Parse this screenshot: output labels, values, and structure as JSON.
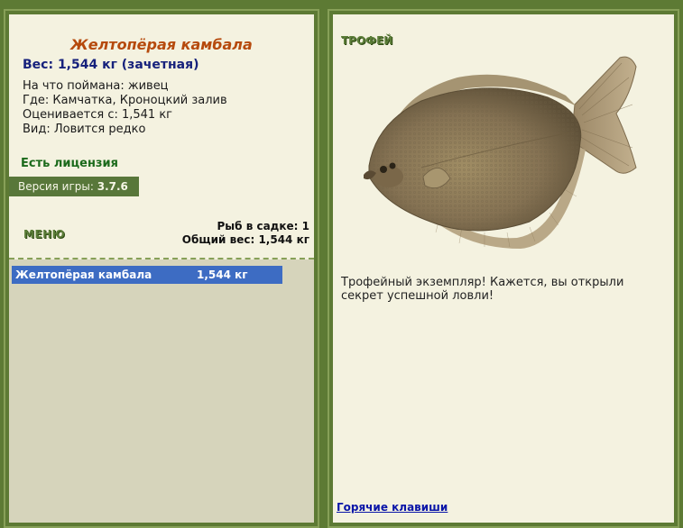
{
  "fish": {
    "name": "Желтопёрая камбала",
    "weight": "Вес: 1,544 кг (зачетная)",
    "bait": "На что поймана: живец",
    "location": "Где: Камчатка, Кроноцкий залив",
    "min_weight": "Оценивается с: 1,541 кг",
    "rarity": "Вид: Ловится редко"
  },
  "license": "Есть лицензия",
  "version": {
    "label": "Версия игры: ",
    "value": "3.7.6"
  },
  "menu_label": "МЕНЮ",
  "cage": {
    "count_label": "Рыб в садке: 1",
    "total_weight": "Общий вес: 1,544 кг"
  },
  "catch_list": [
    {
      "name": "Желтопёрая камбала",
      "weight": "1,544 кг"
    }
  ],
  "trophy": {
    "label": "ТРОФЕЙ",
    "message": "Трофейный экземпляр! Кажется, вы открыли секрет успешной ловли!"
  },
  "hotkeys_link": "Горячие клавиши",
  "colors": {
    "background": "#5d7a34",
    "panel": "#f4f2e0",
    "fish_name": "#b64a0d",
    "selection": "#3d6cc3"
  },
  "icons": [
    "flounder-fish-image"
  ]
}
